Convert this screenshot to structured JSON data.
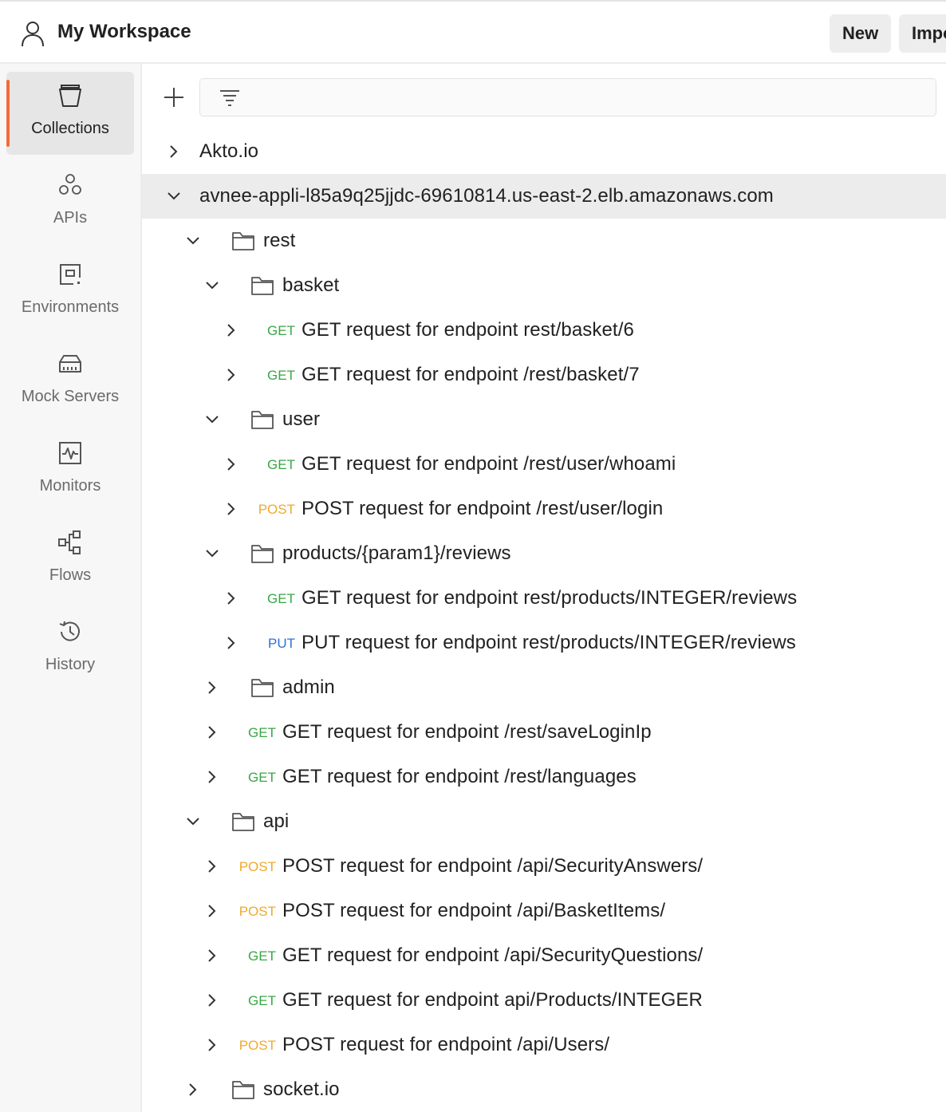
{
  "header": {
    "workspace_title": "My Workspace",
    "new_label": "New",
    "import_label": "Import"
  },
  "sidebar": {
    "items": [
      {
        "label": "Collections",
        "icon": "trash-bin-icon",
        "active": true
      },
      {
        "label": "APIs",
        "icon": "apis-icon"
      },
      {
        "label": "Environments",
        "icon": "environments-icon"
      },
      {
        "label": "Mock Servers",
        "icon": "server-icon"
      },
      {
        "label": "Monitors",
        "icon": "monitor-icon"
      },
      {
        "label": "Flows",
        "icon": "flows-icon"
      },
      {
        "label": "History",
        "icon": "history-icon"
      }
    ]
  },
  "tree": {
    "collection_akto": "Akto.io",
    "collection_avnee": "avnee-appli-l85a9q25jjdc-69610814.us-east-2.elb.amazonaws.com",
    "folder_rest": "rest",
    "folder_basket": "basket",
    "req_basket_6": {
      "method": "GET",
      "name": "GET request for endpoint rest/basket/6"
    },
    "req_basket_7": {
      "method": "GET",
      "name": "GET request for endpoint /rest/basket/7"
    },
    "folder_user": "user",
    "req_user_whoami": {
      "method": "GET",
      "name": "GET request for endpoint /rest/user/whoami"
    },
    "req_user_login": {
      "method": "POST",
      "name": "POST request for endpoint /rest/user/login"
    },
    "folder_reviews": "products/{param1}/reviews",
    "req_reviews_get": {
      "method": "GET",
      "name": "GET request for endpoint rest/products/INTEGER/reviews"
    },
    "req_reviews_put": {
      "method": "PUT",
      "name": "PUT request for endpoint rest/products/INTEGER/reviews"
    },
    "folder_admin": "admin",
    "req_saveloginip": {
      "method": "GET",
      "name": "GET request for endpoint /rest/saveLoginIp"
    },
    "req_languages": {
      "method": "GET",
      "name": "GET request for endpoint /rest/languages"
    },
    "folder_api": "api",
    "req_security_answers": {
      "method": "POST",
      "name": "POST request for endpoint /api/SecurityAnswers/"
    },
    "req_basket_items": {
      "method": "POST",
      "name": "POST request for endpoint /api/BasketItems/"
    },
    "req_security_questions": {
      "method": "GET",
      "name": "GET request for endpoint /api/SecurityQuestions/"
    },
    "req_products_integer": {
      "method": "GET",
      "name": "GET request for endpoint api/Products/INTEGER"
    },
    "req_users": {
      "method": "POST",
      "name": "POST request for endpoint /api/Users/"
    },
    "folder_socketio": "socket.io"
  },
  "colors": {
    "accent": "#f26b3a",
    "get": "#3aa646",
    "post": "#f0a92c",
    "put": "#2c72d4"
  }
}
